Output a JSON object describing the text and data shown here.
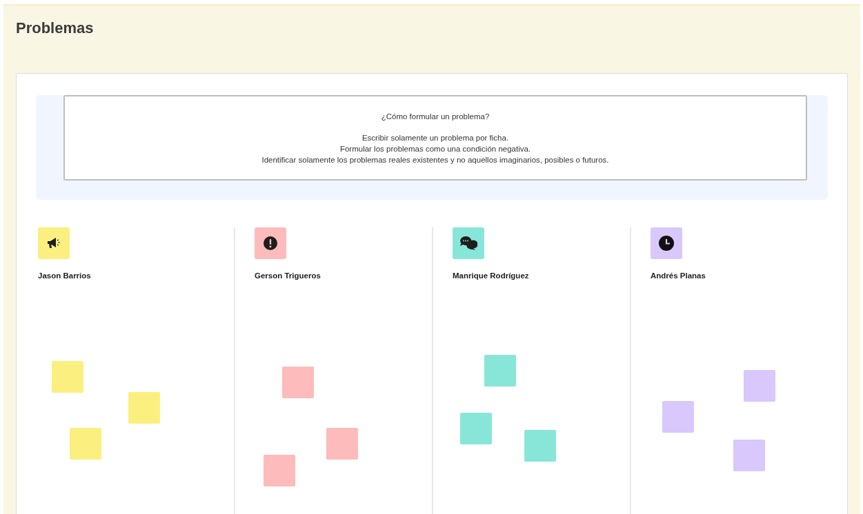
{
  "page": {
    "title": "Problemas"
  },
  "instructions": {
    "heading": "¿Cómo formular un problema?",
    "lines": [
      "Escribir solamente un problema por ficha.",
      "Formular los problemas como una condición negativa.",
      "Identificar solamente los problemas reales existentes y no aquellos imaginarios, posibles o futuros."
    ]
  },
  "columns": [
    {
      "name": "Jason Barrios",
      "color": "#fbf07f",
      "notes": [
        {
          "color": "#fbf07f"
        },
        {
          "color": "#fbf07f"
        },
        {
          "color": "#fbf07f"
        }
      ]
    },
    {
      "name": "Gerson Trigueros",
      "color": "#fdbbbb",
      "notes": [
        {
          "color": "#fdbbbb"
        },
        {
          "color": "#fdbbbb"
        },
        {
          "color": "#fdbbbb"
        }
      ]
    },
    {
      "name": "Manrique Rodríguez",
      "color": "#88e6d9",
      "notes": [
        {
          "color": "#88e6d9"
        },
        {
          "color": "#88e6d9"
        },
        {
          "color": "#88e6d9"
        }
      ]
    },
    {
      "name": "Andrés Planas",
      "color": "#d8c8fb",
      "notes": [
        {
          "color": "#d8c8fb"
        },
        {
          "color": "#d8c8fb"
        },
        {
          "color": "#d8c8fb"
        }
      ]
    }
  ]
}
